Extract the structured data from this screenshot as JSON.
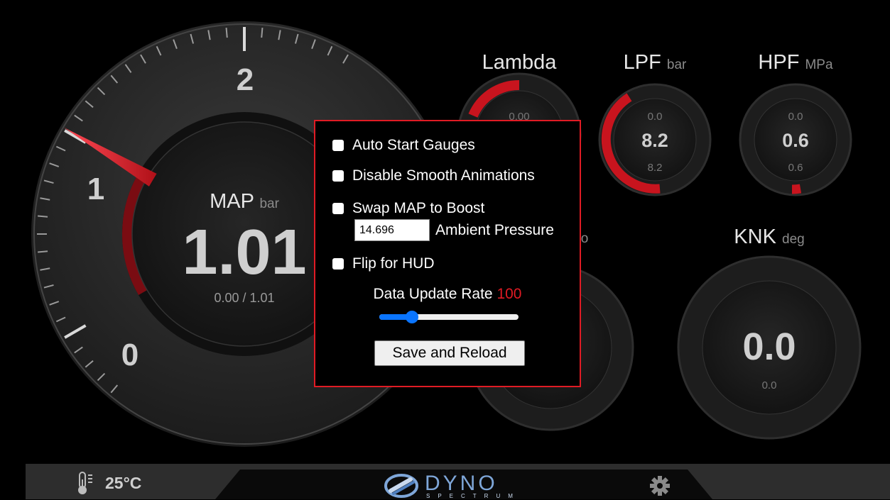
{
  "map_gauge": {
    "title": "MAP",
    "unit": "bar",
    "value": "1.01",
    "minmax": "0.00 / 1.01",
    "scale_labels": [
      "0",
      "1",
      "2"
    ],
    "needle_value": 1.01
  },
  "lambda_gauge": {
    "title": "Lambda",
    "min": "0.00"
  },
  "lpf_gauge": {
    "title": "LPF",
    "unit": "bar",
    "min": "0.0",
    "value": "8.2",
    "max": "8.2"
  },
  "hpf_gauge": {
    "title": "HPF",
    "unit": "MPa",
    "min": "0.0",
    "value": "0.6",
    "max": "0.6"
  },
  "knk_gauge": {
    "title": "KNK",
    "unit": "deg",
    "value": "0.0",
    "max": "0.0"
  },
  "partial_unit_char": "o",
  "bottom_bar": {
    "temperature": "25°C",
    "logo_title": "DYNO",
    "logo_subtitle": "SPECTRUM"
  },
  "settings": {
    "auto_start_label": "Auto Start Gauges",
    "disable_smooth_label": "Disable Smooth Animations",
    "swap_map_label": "Swap MAP to Boost",
    "ambient_value": "14.696",
    "ambient_label": "Ambient Pressure",
    "flip_hud_label": "Flip for HUD",
    "rate_label": "Data Update Rate",
    "rate_value": "100",
    "save_label": "Save and Reload"
  },
  "colors": {
    "accent_red": "#e01b24",
    "slider_blue": "#0a75ff",
    "gauge_red": "#c8141e"
  }
}
